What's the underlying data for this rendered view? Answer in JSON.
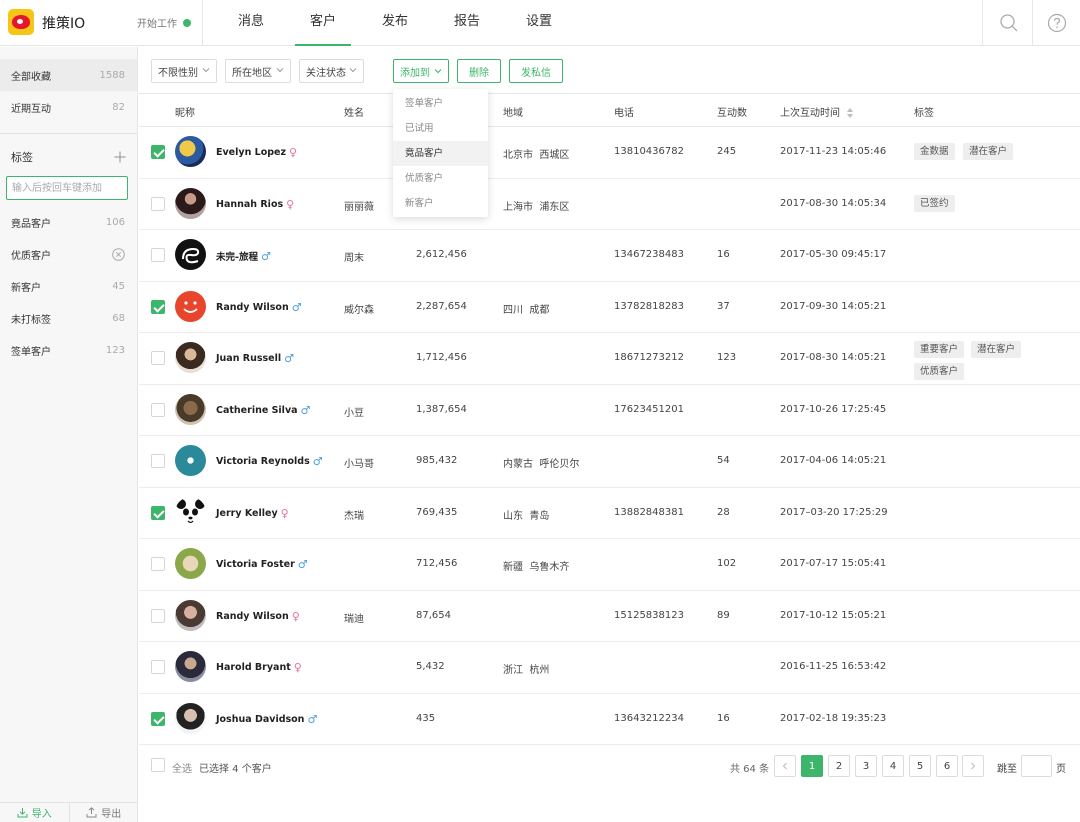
{
  "app": {
    "name": "推策IO",
    "status": "开始工作",
    "status_color": "#3db56a",
    "accent": "#3db56a"
  },
  "nav": {
    "tabs": [
      "消息",
      "客户",
      "发布",
      "报告",
      "设置"
    ],
    "active": 1
  },
  "sidebar": {
    "collections": [
      {
        "label": "全部收藏",
        "count": "1588"
      },
      {
        "label": "近期互动",
        "count": "82"
      }
    ],
    "tags_title": "标签",
    "tag_input_placeholder": "输入后按回车键添加",
    "tags": [
      {
        "label": "竟品客户",
        "count": "106"
      },
      {
        "label": "优质客户",
        "count": ""
      },
      {
        "label": "新客户",
        "count": "45"
      },
      {
        "label": "未打标签",
        "count": "68"
      },
      {
        "label": "签单客户",
        "count": "123"
      }
    ],
    "import_label": "导入",
    "export_label": "导出"
  },
  "toolbar": {
    "filter_gender": "不限性别",
    "filter_region": "所在地区",
    "filter_follow": "关注状态",
    "add_to": "添加到",
    "delete": "删除",
    "message": "发私信"
  },
  "dropdown": {
    "items": [
      "签单客户",
      "已试用",
      "竟品客户",
      "优质客户",
      "新客户"
    ],
    "active": 2
  },
  "table": {
    "headers": {
      "nickname": "昵称",
      "name": "姓名",
      "region": "地域",
      "phone": "电话",
      "interactions": "互动数",
      "last_time": "上次互动时间",
      "tags": "标签"
    },
    "rows": [
      {
        "checked": true,
        "nick": "Evelyn Lopez",
        "gender": "f",
        "name": "",
        "followers": "",
        "region": "北京市  西城区",
        "phone": "13810436782",
        "count": "245",
        "time": "2017-11-23 14:05:46",
        "tags": [
          "金数据",
          "潜在客户"
        ]
      },
      {
        "checked": false,
        "nick": "Hannah Rios",
        "gender": "f",
        "name": "丽丽薇",
        "followers": "",
        "region": "上海市  浦东区",
        "phone": "",
        "count": "",
        "time": "2017-08-30 14:05:34",
        "tags": [
          "已签约"
        ]
      },
      {
        "checked": false,
        "nick": "未完-旅程",
        "gender": "m",
        "name": "周末",
        "followers": "2,612,456",
        "region": "",
        "phone": "13467238483",
        "count": "16",
        "time": "2017-05-30 09:45:17",
        "tags": []
      },
      {
        "checked": true,
        "nick": "Randy Wilson",
        "gender": "m",
        "name": "威尔森",
        "followers": "2,287,654",
        "region": "四川  成都",
        "phone": "13782818283",
        "count": "37",
        "time": "2017-09-30 14:05:21",
        "tags": []
      },
      {
        "checked": false,
        "nick": "Juan Russell",
        "gender": "m",
        "name": "",
        "followers": "1,712,456",
        "region": "",
        "phone": "18671273212",
        "count": "123",
        "time": "2017-08-30 14:05:21",
        "tags": [
          "重要客户",
          "潜在客户",
          "优质客户"
        ]
      },
      {
        "checked": false,
        "nick": "Catherine Silva",
        "gender": "m",
        "name": "小豆",
        "followers": "1,387,654",
        "region": "",
        "phone": "17623451201",
        "count": "",
        "time": "2017-10-26 17:25:45",
        "tags": []
      },
      {
        "checked": false,
        "nick": "Victoria Reynolds",
        "gender": "m",
        "name": "小马哥",
        "followers": "985,432",
        "region": "内蒙古  呼伦贝尔",
        "phone": "",
        "count": "54",
        "time": "2017-04-06 14:05:21",
        "tags": []
      },
      {
        "checked": true,
        "nick": "Jerry Kelley",
        "gender": "f",
        "name": "杰瑞",
        "followers": "769,435",
        "region": "山东  青岛",
        "phone": "13882848381",
        "count": "28",
        "time": "2017–03-20 17:25:29",
        "tags": []
      },
      {
        "checked": false,
        "nick": "Victoria Foster",
        "gender": "m",
        "name": "",
        "followers": "712,456",
        "region": "新疆  乌鲁木齐",
        "phone": "",
        "count": "102",
        "time": "2017-07-17 15:05:41",
        "tags": []
      },
      {
        "checked": false,
        "nick": "Randy Wilson",
        "gender": "f",
        "name": "瑞迪",
        "followers": "87,654",
        "region": "",
        "phone": "15125838123",
        "count": "89",
        "time": "2017-10-12 15:05:21",
        "tags": []
      },
      {
        "checked": false,
        "nick": "Harold Bryant",
        "gender": "f",
        "name": "",
        "followers": "5,432",
        "region": "浙江  杭州",
        "phone": "",
        "count": "",
        "time": "2016-11-25 16:53:42",
        "tags": []
      },
      {
        "checked": true,
        "nick": "Joshua Davidson",
        "gender": "m",
        "name": "",
        "followers": "435",
        "region": "",
        "phone": "13643212234",
        "count": "16",
        "time": "2017-02-18 19:35:23",
        "tags": []
      }
    ]
  },
  "footer": {
    "select_all": "全选",
    "selected": "已选择 4 个客户",
    "total": "共 64 条",
    "pages": [
      "1",
      "2",
      "3",
      "4",
      "5",
      "6"
    ],
    "current_page": "1",
    "goto_label": "跳至",
    "page_unit": "页"
  }
}
